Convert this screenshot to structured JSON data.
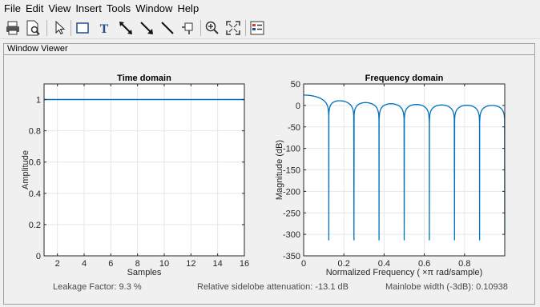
{
  "menu": [
    "File",
    "Edit",
    "View",
    "Insert",
    "Tools",
    "Window",
    "Help"
  ],
  "toolbar": {
    "icons": [
      "print-icon",
      "print-preview-icon",
      "pointer-icon",
      "rectangle-icon",
      "text-icon",
      "double-arrow-icon",
      "arrow-icon",
      "line-icon",
      "pin-icon",
      "zoom-in-icon",
      "fit-to-window-icon",
      "legend-icon"
    ]
  },
  "panel": {
    "title": "Window Viewer"
  },
  "footer": {
    "leakage": "Leakage Factor: 9.3 %",
    "sidelobe": "Relative sidelobe attenuation: -13.1 dB",
    "mainlobe": "Mainlobe width (-3dB): 0.10938"
  },
  "colors": {
    "line": "#0072bd",
    "grid": "#e6e6e6",
    "axes": "#262626"
  },
  "chart_data": [
    {
      "type": "line",
      "title": "Time domain",
      "xlabel": "Samples",
      "ylabel": "Amplitude",
      "xlim": [
        1,
        16
      ],
      "ylim": [
        0,
        1.1
      ],
      "xticks": [
        2,
        4,
        6,
        8,
        10,
        12,
        14,
        16
      ],
      "yticks": [
        0,
        0.2,
        0.4,
        0.6,
        0.8,
        1
      ],
      "grid": true,
      "x": [
        1,
        16
      ],
      "y": [
        1,
        1
      ]
    },
    {
      "type": "line",
      "title": "Frequency domain",
      "xlabel": "Normalized  Frequency    ( ×π  rad/sample)",
      "ylabel": "Magnitude (dB)",
      "xlim": [
        0,
        1
      ],
      "ylim": [
        -350,
        50
      ],
      "xticks": [
        0,
        0.2,
        0.4,
        0.6,
        0.8
      ],
      "yticks": [
        50,
        0,
        -50,
        -100,
        -150,
        -200,
        -250,
        -300,
        -350
      ],
      "grid": true,
      "window_length": 16,
      "null_floor_db": -314
    }
  ]
}
